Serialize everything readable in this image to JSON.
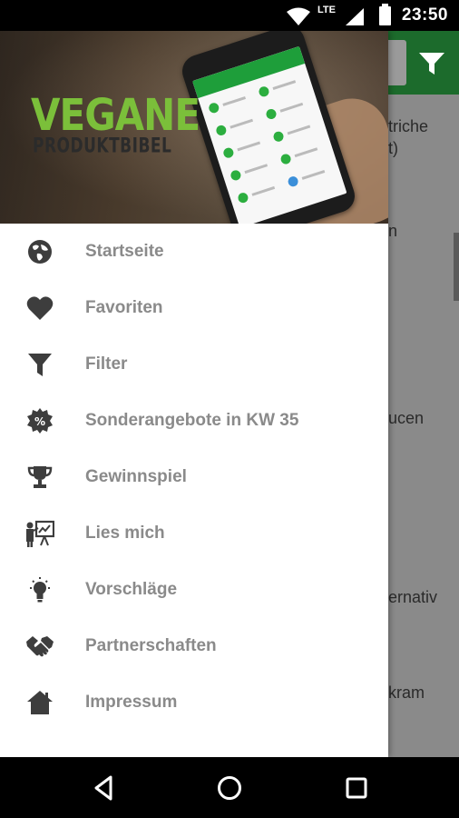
{
  "status_bar": {
    "network": "LTE",
    "time": "23:50"
  },
  "background_app": {
    "visible_text_fragments": [
      "triche",
      "t)",
      "n",
      "ucen",
      "ernativ",
      "kram"
    ],
    "colors": {
      "toolbar": "#1c6b2c",
      "scrim": "#8a8a8a"
    }
  },
  "drawer": {
    "header": {
      "logo_line1": "VEGANE",
      "logo_line2": "PRODUKTBIBEL"
    },
    "items": [
      {
        "label": "Startseite",
        "icon": "globe-icon"
      },
      {
        "label": "Favoriten",
        "icon": "heart-icon"
      },
      {
        "label": "Filter",
        "icon": "filter-icon"
      },
      {
        "label": "Sonderangebote in KW 35",
        "icon": "percent-badge-icon"
      },
      {
        "label": "Gewinnspiel",
        "icon": "trophy-icon"
      },
      {
        "label": "Lies mich",
        "icon": "presentation-icon"
      },
      {
        "label": "Vorschläge",
        "icon": "lightbulb-icon"
      },
      {
        "label": "Partnerschaften",
        "icon": "handshake-icon"
      },
      {
        "label": "Impressum",
        "icon": "home-icon"
      }
    ]
  },
  "nav_bar": {
    "buttons": [
      "back-icon",
      "home-circle-icon",
      "recents-icon"
    ]
  },
  "colors": {
    "brand_green": "#7bbf3a",
    "menu_text": "#8a8a8a",
    "icon": "#3d3d3d"
  }
}
